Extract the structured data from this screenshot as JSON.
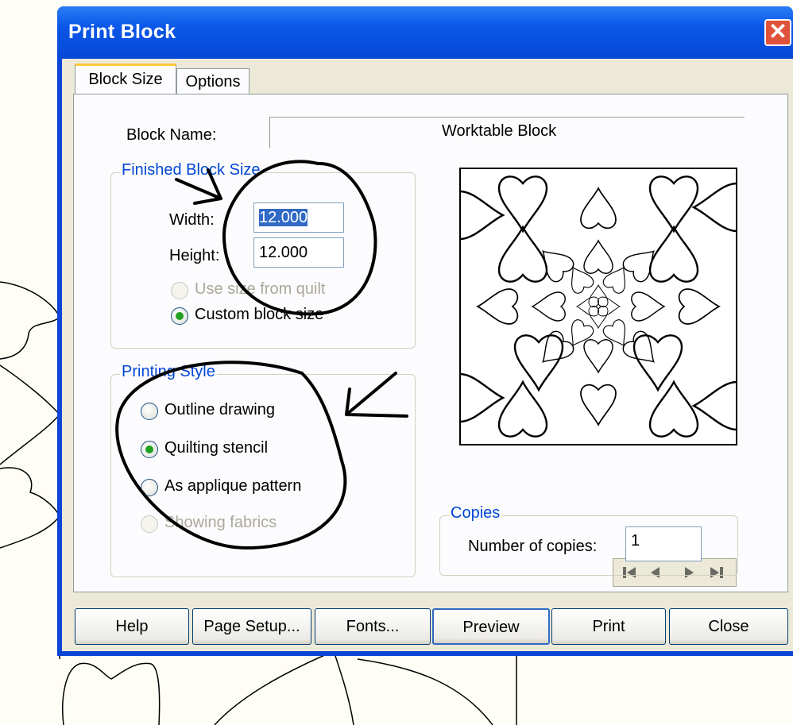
{
  "window": {
    "title": "Print Block",
    "close_icon": "close-icon"
  },
  "tabs": [
    {
      "label": "Block Size",
      "active": true
    },
    {
      "label": "Options",
      "active": false
    }
  ],
  "block_name": {
    "label": "Block Name:",
    "value": "Worktable Block"
  },
  "finished_block_size": {
    "title": "Finished Block Size",
    "width_label": "Width:",
    "width_value": "12.000",
    "height_label": "Height:",
    "height_value": "12.000",
    "use_size_label": "Use size from quilt",
    "use_size_enabled": false,
    "custom_label": "Custom block size",
    "custom_selected": true
  },
  "printing_style": {
    "title": "Printing Style",
    "options": [
      {
        "label": "Outline drawing",
        "selected": false,
        "enabled": true
      },
      {
        "label": "Quilting stencil",
        "selected": true,
        "enabled": true
      },
      {
        "label": "As applique pattern",
        "selected": false,
        "enabled": true
      },
      {
        "label": "Showing fabrics",
        "selected": false,
        "enabled": false
      }
    ]
  },
  "navigation": {
    "icons": [
      "first-page-icon",
      "previous-page-icon",
      "next-page-icon",
      "last-page-icon"
    ]
  },
  "copies": {
    "title": "Copies",
    "label": "Number of copies:",
    "value": "1"
  },
  "buttons": {
    "help": "Help",
    "page_setup": "Page Setup...",
    "fonts": "Fonts...",
    "preview": "Preview",
    "print": "Print",
    "close": "Close"
  },
  "colors": {
    "title_bar": "#0a56e8",
    "group_title": "#0046d5",
    "selection": "#316ac5",
    "radio_dot": "#21a121"
  }
}
